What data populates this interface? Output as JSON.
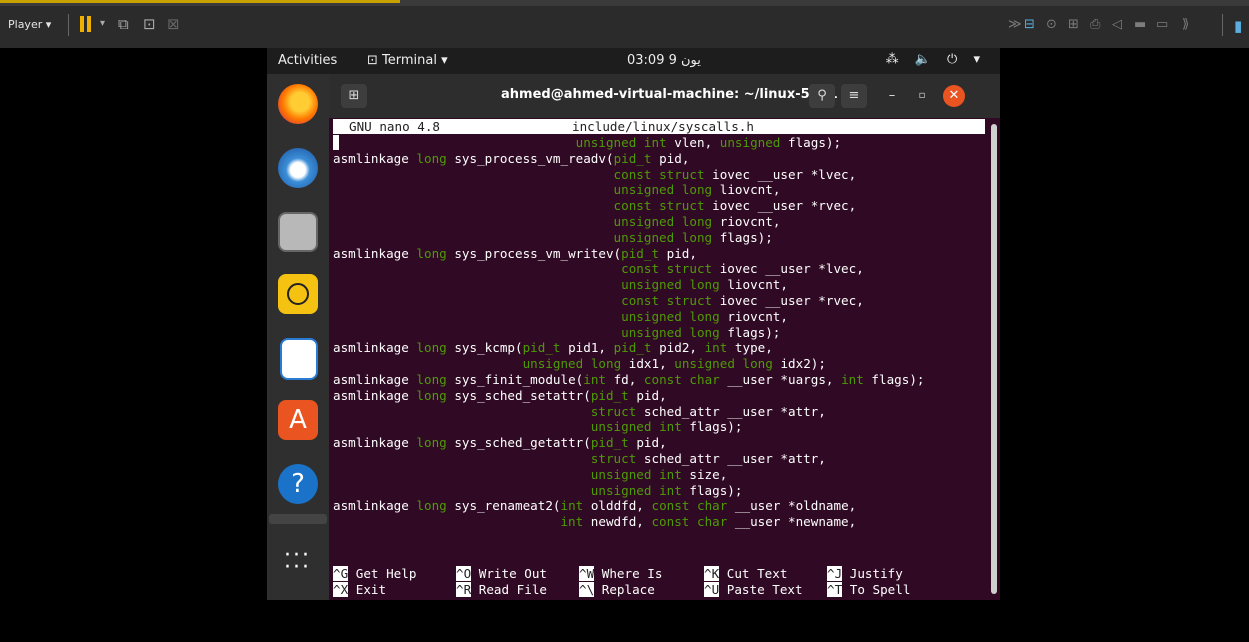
{
  "player": {
    "menu_label": "Player ▾"
  },
  "vm": {
    "topbar": {
      "activities": "Activities",
      "app_menu": "Terminal ▾",
      "clock": "03:09 9 يون",
      "tray": "⁂ 🔈 ⏻ ▾"
    },
    "terminal": {
      "title": "ahmed@ahmed-virtual-machine: ~/linux-5.8.1",
      "nano_version": "GNU nano 4.8",
      "file_name": "include/linux/syscalls.h",
      "lines": [
        "                                unsigned int vlen, unsigned flags);",
        "asmlinkage long sys_process_vm_readv(pid_t pid,",
        "                                     const struct iovec __user *lvec,",
        "                                     unsigned long liovcnt,",
        "                                     const struct iovec __user *rvec,",
        "                                     unsigned long riovcnt,",
        "                                     unsigned long flags);",
        "asmlinkage long sys_process_vm_writev(pid_t pid,",
        "                                      const struct iovec __user *lvec,",
        "                                      unsigned long liovcnt,",
        "                                      const struct iovec __user *rvec,",
        "                                      unsigned long riovcnt,",
        "                                      unsigned long flags);",
        "asmlinkage long sys_kcmp(pid_t pid1, pid_t pid2, int type,",
        "                         unsigned long idx1, unsigned long idx2);",
        "asmlinkage long sys_finit_module(int fd, const char __user *uargs, int flags);",
        "asmlinkage long sys_sched_setattr(pid_t pid,",
        "                                  struct sched_attr __user *attr,",
        "                                  unsigned int flags);",
        "asmlinkage long sys_sched_getattr(pid_t pid,",
        "                                  struct sched_attr __user *attr,",
        "                                  unsigned int size,",
        "                                  unsigned int flags);",
        "asmlinkage long sys_renameat2(int olddfd, const char __user *oldname,",
        "                              int newdfd, const char __user *newname,"
      ],
      "shortcuts_row1": [
        {
          "key": "^G",
          "label": "Get Help"
        },
        {
          "key": "^O",
          "label": "Write Out"
        },
        {
          "key": "^W",
          "label": "Where Is"
        },
        {
          "key": "^K",
          "label": "Cut Text"
        },
        {
          "key": "^J",
          "label": "Justify"
        }
      ],
      "shortcuts_row2": [
        {
          "key": "^X",
          "label": "Exit"
        },
        {
          "key": "^R",
          "label": "Read File"
        },
        {
          "key": "^\\",
          "label": "Replace"
        },
        {
          "key": "^U",
          "label": "Paste Text"
        },
        {
          "key": "^T",
          "label": "To Spell"
        }
      ]
    }
  },
  "colors": {
    "keyword": "#4e9a06",
    "terminal_bg": "#300a24",
    "accent": "#f0b000"
  }
}
